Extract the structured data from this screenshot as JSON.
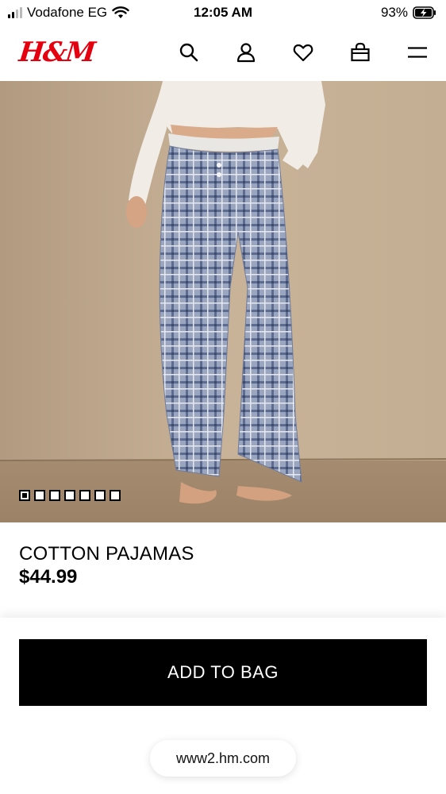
{
  "status_bar": {
    "carrier": "Vodafone EG",
    "time": "12:05 AM",
    "battery_percent": "93%",
    "signal_bars": 2,
    "icons": [
      "signal-icon",
      "wifi-icon",
      "battery-charging-icon"
    ]
  },
  "header": {
    "logo_text": "H&M",
    "icons": [
      "search-icon",
      "account-icon",
      "favorites-heart-icon",
      "shopping-bag-icon",
      "menu-icon"
    ],
    "brand_color": "#e50010"
  },
  "gallery": {
    "image_count": 7,
    "active_index": 0
  },
  "product": {
    "title": "COTTON PAJAMAS",
    "price": "$44.99"
  },
  "actions": {
    "add_to_bag_label": "ADD TO BAG"
  },
  "browser": {
    "url": "www2.hm.com"
  }
}
